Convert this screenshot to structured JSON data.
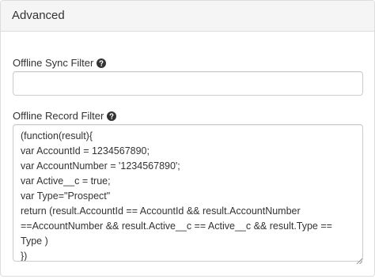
{
  "panel": {
    "title": "Advanced"
  },
  "sync_filter": {
    "label": "Offline Sync Filter",
    "value": "",
    "help_icon": "question-circle-icon"
  },
  "record_filter": {
    "label": "Offline Record Filter",
    "help_icon": "question-circle-icon",
    "value": "(function(result){\nvar AccountId = 1234567890;\nvar AccountNumber = '1234567890';\nvar Active__c = true;\nvar Type=\"Prospect\"\nreturn (result.AccountId == AccountId && result.AccountNumber ==AccountNumber && result.Active__c == Active__c && result.Type == Type )\n})"
  },
  "colors": {
    "heading_bg": "#f5f5f5",
    "border": "#dddddd",
    "input_border": "#cccccc",
    "text": "#333333"
  }
}
